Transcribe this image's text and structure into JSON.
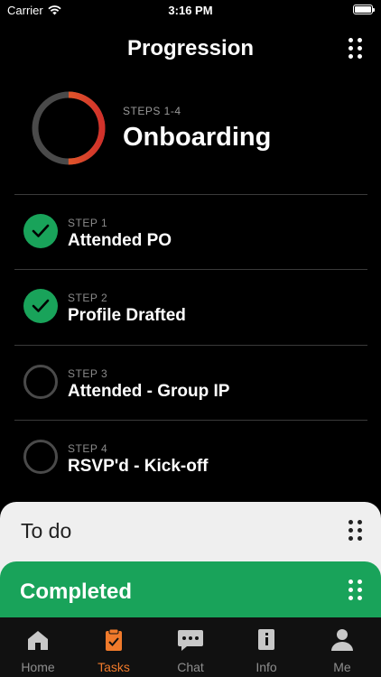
{
  "status_bar": {
    "carrier": "Carrier",
    "time": "3:16 PM"
  },
  "header": {
    "title": "Progression",
    "menu_icon": "grid-dots-icon"
  },
  "overview": {
    "subtitle": "STEPS 1-4",
    "title": "Onboarding",
    "progress": 0.5,
    "progress_colors": [
      "#f07a2b",
      "#d1312a"
    ],
    "track_color": "#4a4a4a"
  },
  "steps": [
    {
      "number": "STEP 1",
      "name": "Attended PO",
      "completed": true
    },
    {
      "number": "STEP 2",
      "name": "Profile Drafted",
      "completed": true
    },
    {
      "number": "STEP 3",
      "name": "Attended - Group IP",
      "completed": false
    },
    {
      "number": "STEP 4",
      "name": "RSVP'd - Kick-off",
      "completed": false
    }
  ],
  "cards": {
    "todo": "To do",
    "completed": "Completed"
  },
  "tabs": [
    {
      "label": "Home",
      "icon": "home-icon",
      "active": false
    },
    {
      "label": "Tasks",
      "icon": "clipboard-icon",
      "active": true
    },
    {
      "label": "Chat",
      "icon": "chat-icon",
      "active": false
    },
    {
      "label": "Info",
      "icon": "book-icon",
      "active": false
    },
    {
      "label": "Me",
      "icon": "person-icon",
      "active": false
    }
  ],
  "colors": {
    "accent": "#f07a2b",
    "success": "#19a35a",
    "background": "#000000"
  }
}
